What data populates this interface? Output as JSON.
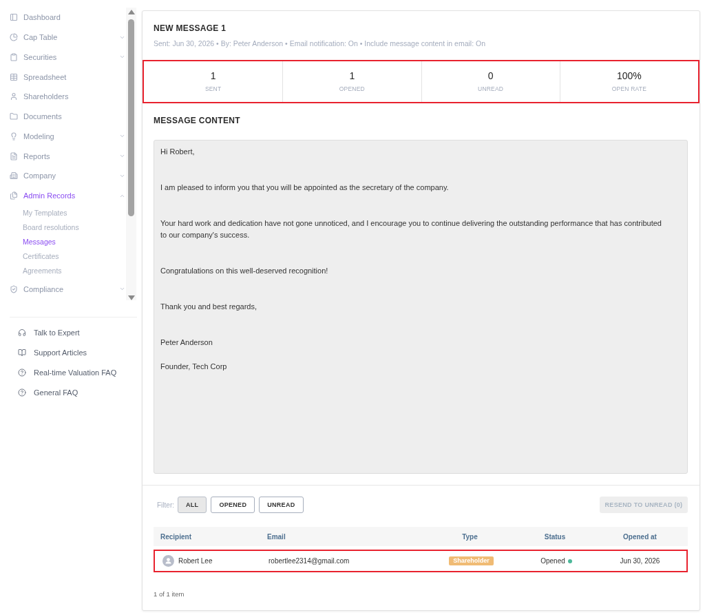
{
  "sidebar": {
    "items": [
      {
        "label": "Dashboard",
        "kind": "link",
        "selected": false
      },
      {
        "label": "Cap Table",
        "kind": "group",
        "selected": false,
        "expanded": false
      },
      {
        "label": "Securities",
        "kind": "group",
        "selected": false,
        "expanded": false
      },
      {
        "label": "Spreadsheet",
        "kind": "link",
        "selected": false
      },
      {
        "label": "Shareholders",
        "kind": "link",
        "selected": false
      },
      {
        "label": "Documents",
        "kind": "link",
        "selected": false
      },
      {
        "label": "Modeling",
        "kind": "group",
        "selected": false,
        "expanded": false
      },
      {
        "label": "Reports",
        "kind": "group",
        "selected": false,
        "expanded": false
      },
      {
        "label": "Company",
        "kind": "group",
        "selected": false,
        "expanded": false
      },
      {
        "label": "Admin Records",
        "kind": "group",
        "selected": true,
        "expanded": true,
        "children": [
          {
            "label": "My Templates",
            "selected": false
          },
          {
            "label": "Board resolutions",
            "selected": false
          },
          {
            "label": "Messages",
            "selected": true
          },
          {
            "label": "Certificates",
            "selected": false
          },
          {
            "label": "Agreements",
            "selected": false
          }
        ]
      },
      {
        "label": "Compliance",
        "kind": "group",
        "selected": false,
        "expanded": false
      }
    ],
    "help_links": [
      {
        "label": "Talk to Expert"
      },
      {
        "label": "Support Articles"
      },
      {
        "label": "Real-time Valuation FAQ"
      },
      {
        "label": "General FAQ"
      }
    ]
  },
  "message": {
    "title": "NEW MESSAGE 1",
    "meta": "Sent: Jun 30, 2026 • By: Peter Anderson • Email notification: On • Include message content in email: On"
  },
  "stats": {
    "highlighted": true,
    "items": [
      {
        "value": "1",
        "label": "SENT"
      },
      {
        "value": "1",
        "label": "OPENED"
      },
      {
        "value": "0",
        "label": "UNREAD"
      },
      {
        "value": "100%",
        "label": "OPEN RATE"
      }
    ]
  },
  "content": {
    "heading": "MESSAGE CONTENT",
    "blocks": [
      [
        "Hi Robert,"
      ],
      [
        "I am pleased to inform you that you will be appointed as the secretary of the company."
      ],
      [
        "Your hard work and dedication have not gone unnoticed, and I encourage you to continue delivering the outstanding performance that has contributed to our company's success."
      ],
      [
        "Congratulations on this well-deserved recognition!"
      ],
      [
        "Thank you and best regards,"
      ],
      [
        "Peter Anderson",
        "Founder, Tech Corp"
      ]
    ]
  },
  "filter": {
    "label": "Filter:",
    "buttons": [
      {
        "label": "ALL",
        "selected": true
      },
      {
        "label": "OPENED",
        "selected": false
      },
      {
        "label": "UNREAD",
        "selected": false
      }
    ]
  },
  "resend_button": {
    "label": "RESEND TO UNREAD (0)",
    "disabled": true
  },
  "table": {
    "columns": [
      "Recipient",
      "Email",
      "Type",
      "Status",
      "Opened at"
    ],
    "rows": [
      {
        "highlighted": true,
        "recipient": "Robert Lee",
        "email": "robertlee2314@gmail.com",
        "type": "Shareholder",
        "status": {
          "text": "Opened",
          "color": "#4db89a"
        },
        "opened_at": "Jun 30, 2026"
      }
    ]
  },
  "pagination": "1 of 1 item"
}
